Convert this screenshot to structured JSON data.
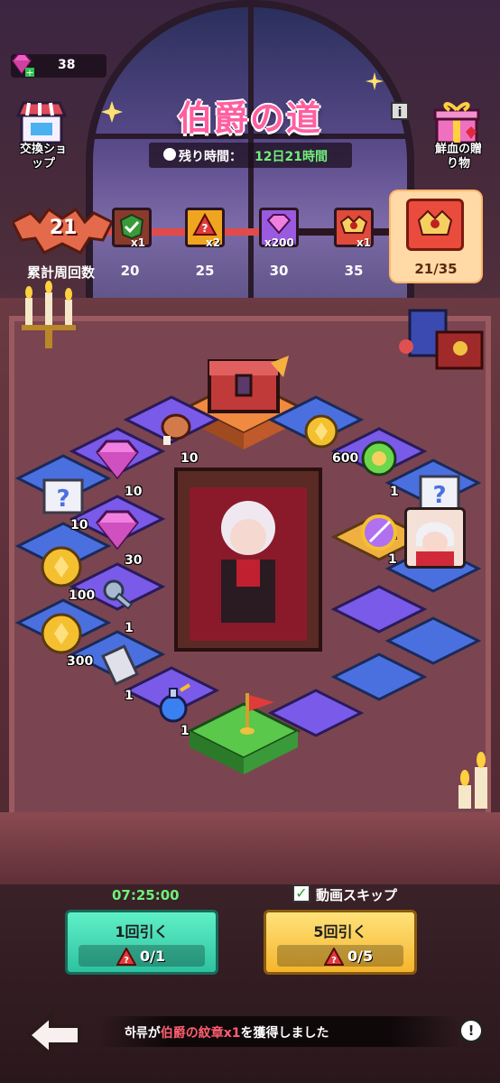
{
  "currency": {
    "gems": "38",
    "gem_icon": "pink-gem-icon"
  },
  "header": {
    "title": "伯爵の道",
    "time_label": "残り時間：",
    "time_value": "12日21時間",
    "shop_label_l1": "交換ショ",
    "shop_label_l2": "ップ",
    "gift_label_l1": "鮮血の贈",
    "gift_label_l2": "り物",
    "info": "i"
  },
  "progress": {
    "laps": "21",
    "laps_label": "累計周回数",
    "fraction": 0.6,
    "milestones": [
      {
        "qty": "x1",
        "threshold": "20",
        "color": "#8a3a2a",
        "icon": "checkmark-crest-icon"
      },
      {
        "qty": "x2",
        "threshold": "25",
        "color": "#f0a520",
        "icon": "red-ticket-icon"
      },
      {
        "qty": "x200",
        "threshold": "30",
        "color": "#9a5ae0",
        "icon": "pink-gem-icon"
      },
      {
        "qty": "x1",
        "threshold": "35",
        "color": "#e04a3a",
        "icon": "count-crest-icon"
      }
    ],
    "current": "21/35"
  },
  "board": {
    "rewards": [
      {
        "label": "10",
        "icon": "meat-icon"
      },
      {
        "label": "600",
        "icon": "gold-coin-icon"
      },
      {
        "label": "10",
        "icon": "pink-gem-icon"
      },
      {
        "label": "1",
        "icon": "green-orb-icon"
      },
      {
        "label": "10",
        "icon": "mystery-scroll-icon"
      },
      {
        "label": "1",
        "icon": "mystery-scroll-icon"
      },
      {
        "label": "30",
        "icon": "pink-gem-icon"
      },
      {
        "label": "1",
        "icon": "purple-compass-icon"
      },
      {
        "label": "100",
        "icon": "gold-coin-icon"
      },
      {
        "label": "1",
        "icon": "silver-key-icon"
      },
      {
        "label": "300",
        "icon": "gold-coin-icon"
      },
      {
        "label": "1",
        "icon": "scroll-icon"
      },
      {
        "label": "1",
        "icon": "blue-potion-icon"
      }
    ]
  },
  "draw": {
    "countdown": "07:25:00",
    "skip_label": "動画スキップ",
    "skip_checked": true,
    "draw1_label": "1回引く",
    "draw1_count": "0/1",
    "draw5_label": "5回引く",
    "draw5_count": "0/5"
  },
  "ticker": {
    "prefix": "하류が",
    "item": "伯爵の紋章x1",
    "suffix": "を獲得しました"
  },
  "colors": {
    "title": "#ff5fa0",
    "timer": "#6ff07a",
    "board_blue": "#4a6fd8",
    "board_purple": "#7a4ad8",
    "board_orange": "#f0a030",
    "board_green": "#5ac84a"
  }
}
